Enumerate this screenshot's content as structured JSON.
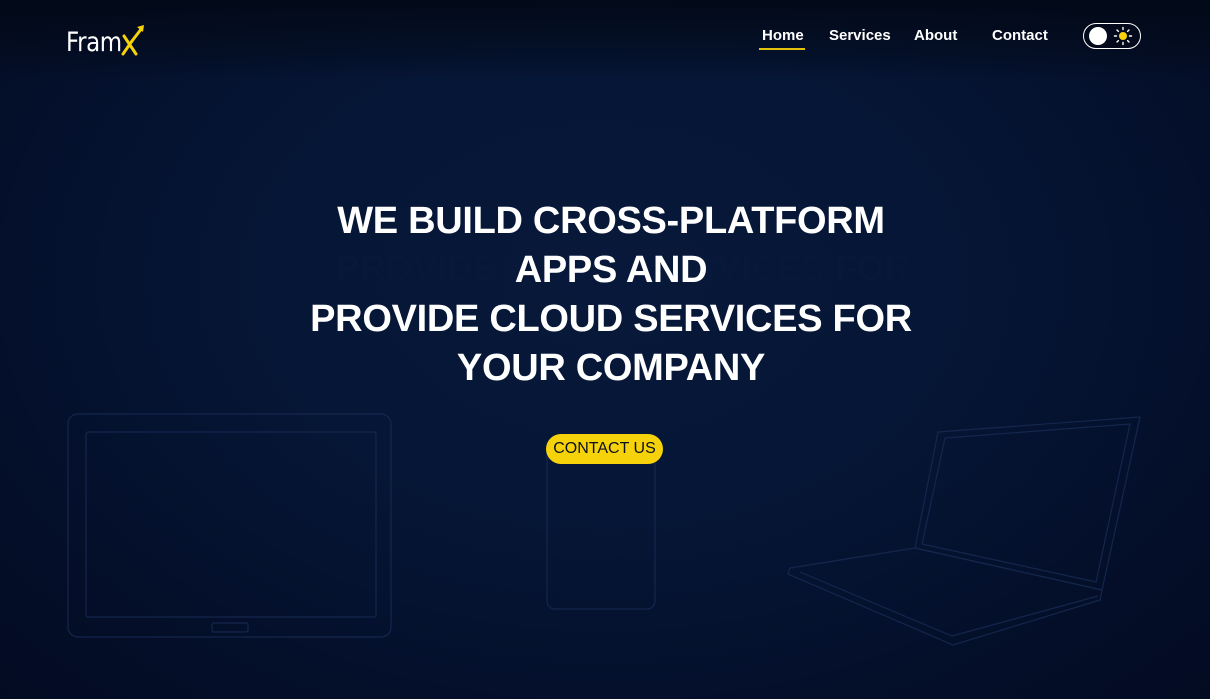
{
  "brand": {
    "name": "Fram",
    "accent_letter": "X",
    "accent_color": "#f5d20a"
  },
  "nav": {
    "items": [
      {
        "label": "Home",
        "active": true
      },
      {
        "label": "Services",
        "active": false
      },
      {
        "label": "About",
        "active": false
      },
      {
        "label": "Contact",
        "active": false
      }
    ],
    "active_underline_color": "#e3c20b"
  },
  "theme_toggle": {
    "state": "dark",
    "icon": "sun-icon"
  },
  "hero": {
    "lines": [
      "WE BUILD CROSS-PLATFORM",
      "APPS AND",
      "PROVIDE CLOUD SERVICES FOR",
      "YOUR COMPANY"
    ],
    "cta_label": "CONTACT US",
    "cta_color": "#f5d20a"
  },
  "colors": {
    "background": "#061636",
    "text": "#ffffff"
  }
}
